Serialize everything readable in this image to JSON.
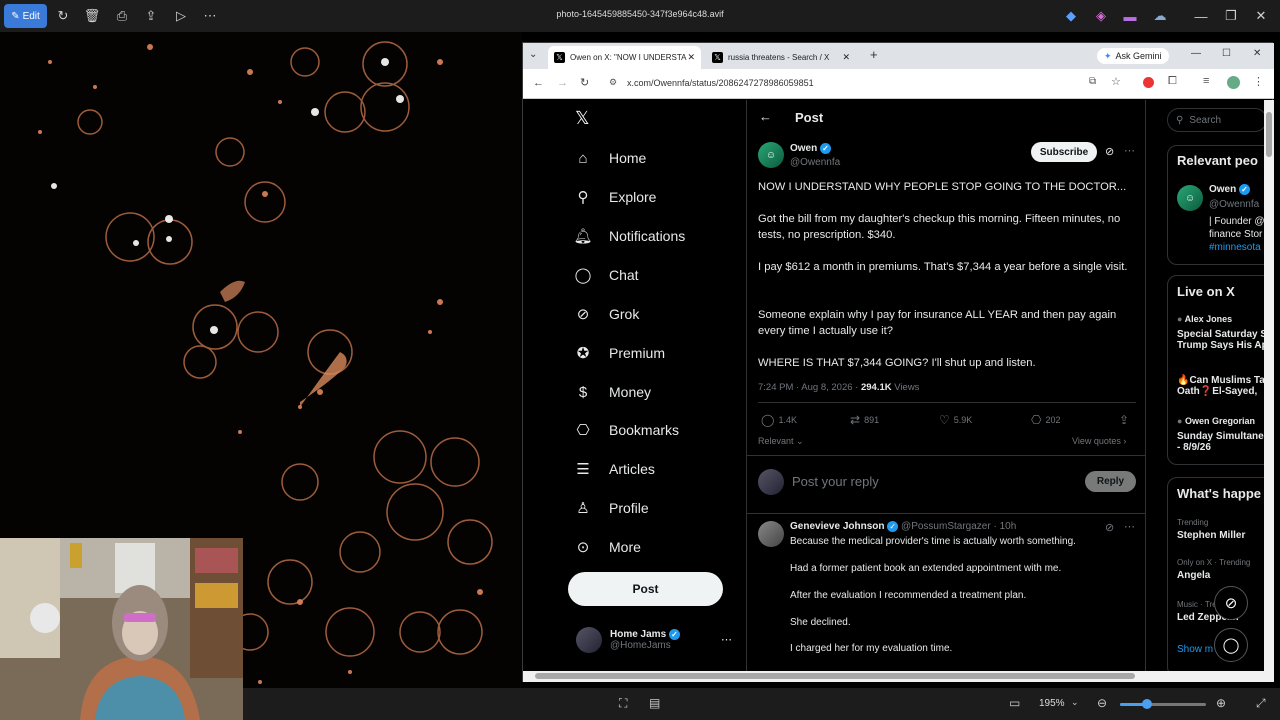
{
  "viewer": {
    "edit_label": "Edit",
    "file_title": "photo-1645459885450-347f3e964c48.avif",
    "zoom": "195%"
  },
  "browser": {
    "tabs": [
      {
        "label": "Owen on X: \"NOW I UNDERSTA"
      },
      {
        "label": "russia threatens - Search / X"
      }
    ],
    "gemini_label": "Ask Gemini",
    "url": "x.com/Owennfa/status/2086247278986059851"
  },
  "x": {
    "nav": [
      {
        "label": "Home",
        "icon": "home-icon"
      },
      {
        "label": "Explore",
        "icon": "search-icon"
      },
      {
        "label": "Notifications",
        "icon": "bell-icon"
      },
      {
        "label": "Chat",
        "icon": "chat-icon"
      },
      {
        "label": "Grok",
        "icon": "grok-icon"
      },
      {
        "label": "Premium",
        "icon": "premium-icon"
      },
      {
        "label": "Money",
        "icon": "money-icon"
      },
      {
        "label": "Bookmarks",
        "icon": "bookmark-icon"
      },
      {
        "label": "Articles",
        "icon": "articles-icon"
      },
      {
        "label": "Profile",
        "icon": "person-icon"
      },
      {
        "label": "More",
        "icon": "more-icon"
      }
    ],
    "post_button": "Post",
    "account": {
      "name": "Home Jams",
      "handle": "@HomeJams"
    },
    "header_title": "Post",
    "post": {
      "author": "Owen",
      "handle": "@Owennfa",
      "subscribe": "Subscribe",
      "paragraphs": [
        "NOW I UNDERSTAND WHY PEOPLE STOP GOING TO THE DOCTOR...",
        "Got the bill from my daughter's checkup this morning. Fifteen minutes, no tests, no prescription. $340.",
        "I pay $612 a month in premiums. That's $7,344 a year before a single visit.",
        "Someone explain why I pay for insurance ALL YEAR and then pay again every time I actually use it?",
        "WHERE IS THAT $7,344 GOING? I'll shut up and listen."
      ],
      "timestamp": "7:24 PM · Aug 8, 2026 ·",
      "views": "294.1K",
      "views_label": "Views",
      "replies": "1.4K",
      "reposts": "891",
      "likes": "5.9K",
      "bookmarks": "202",
      "sort": "Relevant",
      "view_quotes": "View quotes"
    },
    "reply_placeholder": "Post your reply",
    "reply_button": "Reply",
    "reply": {
      "author": "Genevieve Johnson",
      "handle": "@PossumStargazer",
      "time": "· 10h",
      "lines": [
        "Because the medical provider's time is actually worth something.",
        "Had a former patient book an extended appointment with me.",
        "After the evaluation I recommended a treatment plan.",
        "She declined.",
        "I charged  her for my evaluation time."
      ]
    },
    "sidebar": {
      "search_placeholder": "Search",
      "relevant_title": "Relevant peo",
      "relevant_name": "Owen",
      "relevant_handle": "@Owennfa",
      "relevant_bio1": "| Founder @",
      "relevant_bio2": "finance Stor",
      "relevant_bio3": "#minnesota",
      "live_title": "Live on X",
      "live": [
        {
          "host": "Alex Jones",
          "title1": "Special Saturday S",
          "title2": "Trump Says His Ap"
        },
        {
          "host": "",
          "title1": "🔥Can Muslims Ta",
          "title2": "Oath❓El-Sayed,"
        },
        {
          "host": "Owen Gregorian",
          "title1": "Sunday Simultane",
          "title2": "- 8/9/26"
        }
      ],
      "happening_title": "What's happe",
      "trends": [
        {
          "context": "Trending",
          "name": "Stephen Miller"
        },
        {
          "context": "Only on X · Trending",
          "name": "Angela"
        },
        {
          "context": "Music · Tre",
          "name": "Led Zeppelin"
        }
      ],
      "show_more": "Show m"
    }
  }
}
